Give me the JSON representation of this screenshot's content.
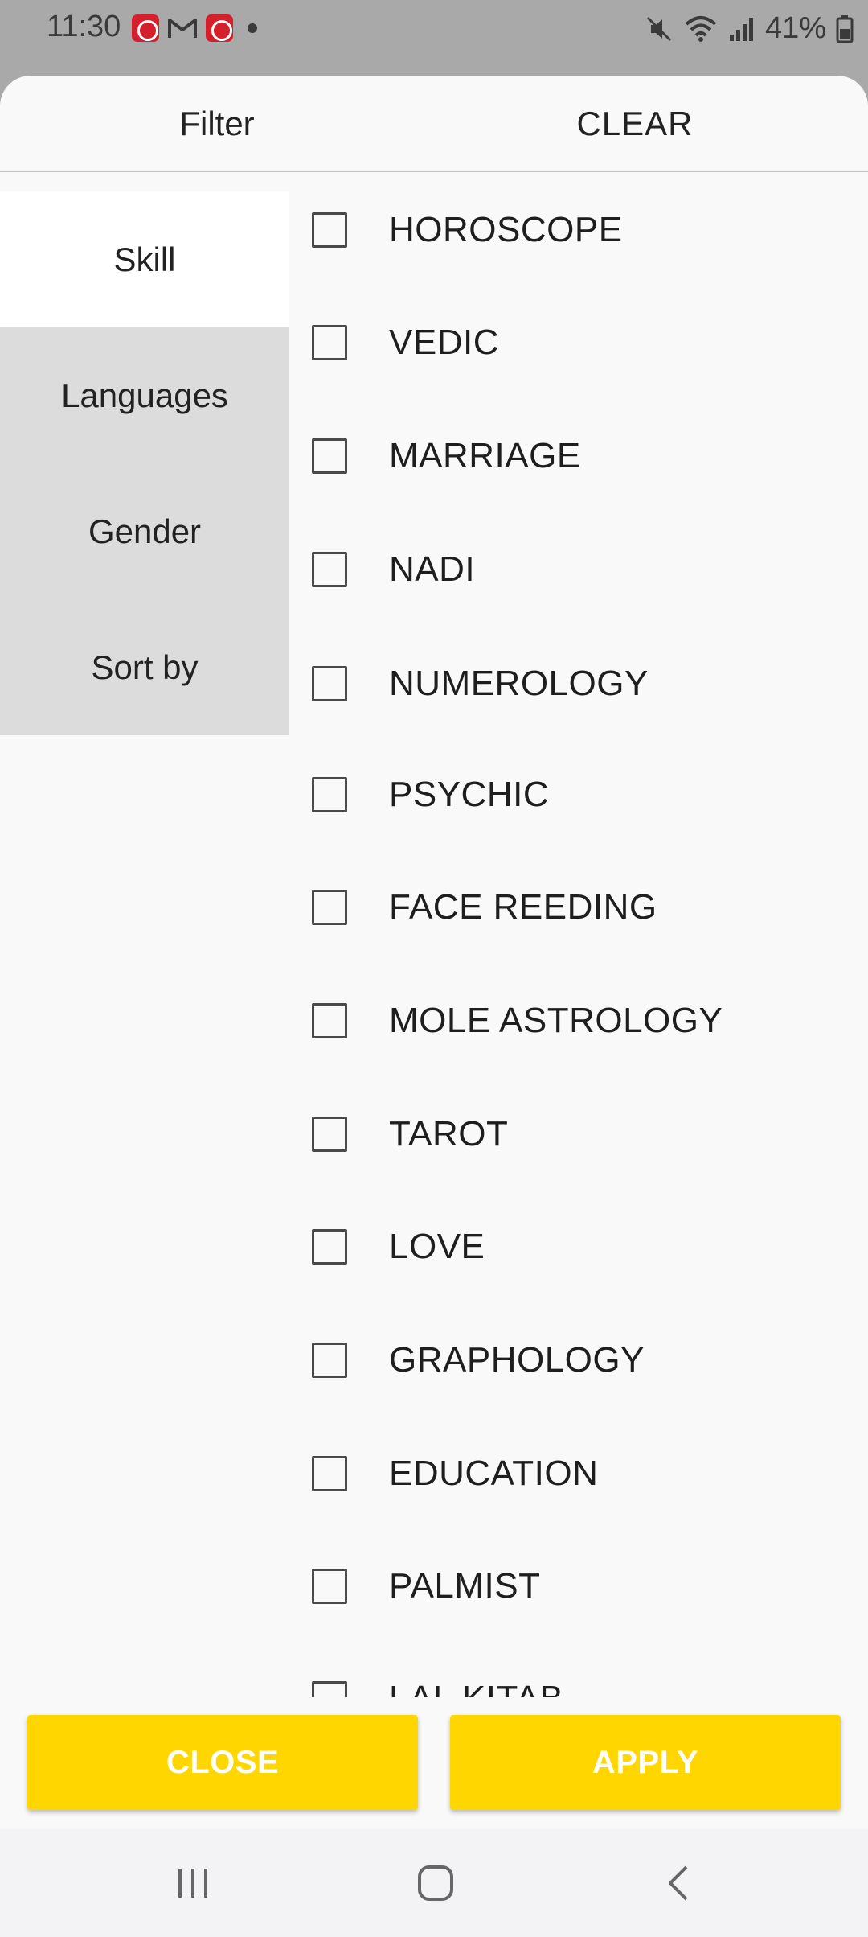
{
  "status_bar": {
    "time": "11:30",
    "notification_icons": [
      "app-icon",
      "gmail-icon",
      "app-icon"
    ],
    "battery": "41%",
    "icons": [
      "mute-icon",
      "wifi-icon",
      "signal-icon",
      "battery-icon"
    ]
  },
  "header": {
    "title": "Filter",
    "clear_label": "CLEAR"
  },
  "sidebar": {
    "tabs": [
      {
        "label": "Skill",
        "active": true
      },
      {
        "label": "Languages",
        "active": false
      },
      {
        "label": "Gender",
        "active": false
      },
      {
        "label": "Sort by",
        "active": false
      }
    ]
  },
  "options": [
    {
      "label": "HOROSCOPE",
      "checked": false
    },
    {
      "label": "VEDIC",
      "checked": false
    },
    {
      "label": "MARRIAGE",
      "checked": false
    },
    {
      "label": "NADI",
      "checked": false
    },
    {
      "label": "NUMEROLOGY",
      "checked": false
    },
    {
      "label": "PSYCHIC",
      "checked": false
    },
    {
      "label": "FACE REEDING",
      "checked": false
    },
    {
      "label": "MOLE ASTROLOGY",
      "checked": false
    },
    {
      "label": "TAROT",
      "checked": false
    },
    {
      "label": "LOVE",
      "checked": false
    },
    {
      "label": "GRAPHOLOGY",
      "checked": false
    },
    {
      "label": "EDUCATION",
      "checked": false
    },
    {
      "label": "PALMIST",
      "checked": false
    },
    {
      "label": "LAL KITAB",
      "checked": false
    }
  ],
  "footer": {
    "close_label": "CLOSE",
    "apply_label": "APPLY"
  },
  "colors": {
    "accent": "#ffd600",
    "button_text": "#ffffff",
    "active_tab": "#ffffff",
    "inactive_tab": "#dcdcdc"
  }
}
